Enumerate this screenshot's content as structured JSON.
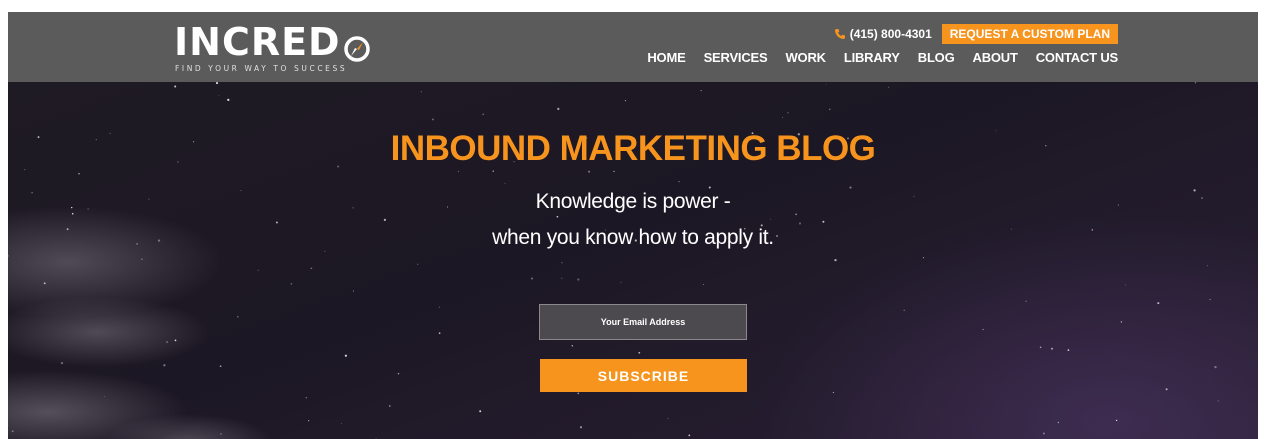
{
  "header": {
    "logo_text": "INCREDO",
    "logo_prefix": "INCRED",
    "tagline": "FIND YOUR WAY TO SUCCESS",
    "phone": "(415) 800-4301",
    "request_button": "REQUEST A CUSTOM PLAN",
    "nav": [
      "HOME",
      "SERVICES",
      "WORK",
      "LIBRARY",
      "BLOG",
      "ABOUT",
      "CONTACT US"
    ]
  },
  "hero": {
    "title": "INBOUND MARKETING BLOG",
    "subtitle_line1": "Knowledge is power -",
    "subtitle_line2": "when you know how to apply it.",
    "email_placeholder": "Your Email Address",
    "subscribe_button": "SUBSCRIBE"
  },
  "colors": {
    "accent": "#f7941d",
    "header_bg": "#5b5b5b",
    "hero_bg": "#1f1b24"
  },
  "icons": [
    "compass-icon",
    "phone-icon"
  ]
}
